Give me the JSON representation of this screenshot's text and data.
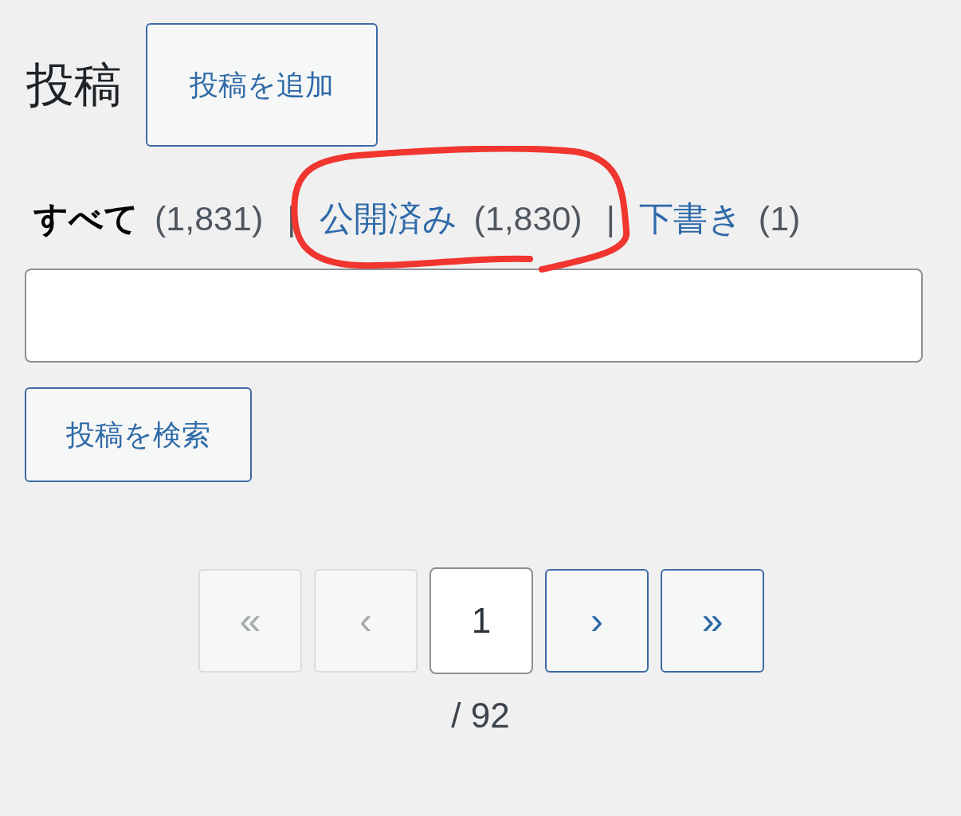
{
  "title": "投稿",
  "add_button": "投稿を追加",
  "filters": [
    {
      "label": "すべて",
      "count": "(1,831)",
      "selected": true,
      "separator": "|"
    },
    {
      "label": "公開済み",
      "count": "(1,830)",
      "selected": false,
      "separator": "|"
    },
    {
      "label": "下書き",
      "count": "(1)",
      "selected": false
    }
  ],
  "search_button": "投稿を検索",
  "pagination": {
    "items": [
      {
        "kind": "nav",
        "label": "«",
        "disabled": true
      },
      {
        "kind": "nav",
        "label": "‹",
        "disabled": true
      },
      {
        "kind": "current",
        "value": "1"
      },
      {
        "kind": "nav",
        "label": "›",
        "disabled": false
      },
      {
        "kind": "nav",
        "label": "»",
        "disabled": false
      }
    ],
    "total": "/ 92"
  }
}
